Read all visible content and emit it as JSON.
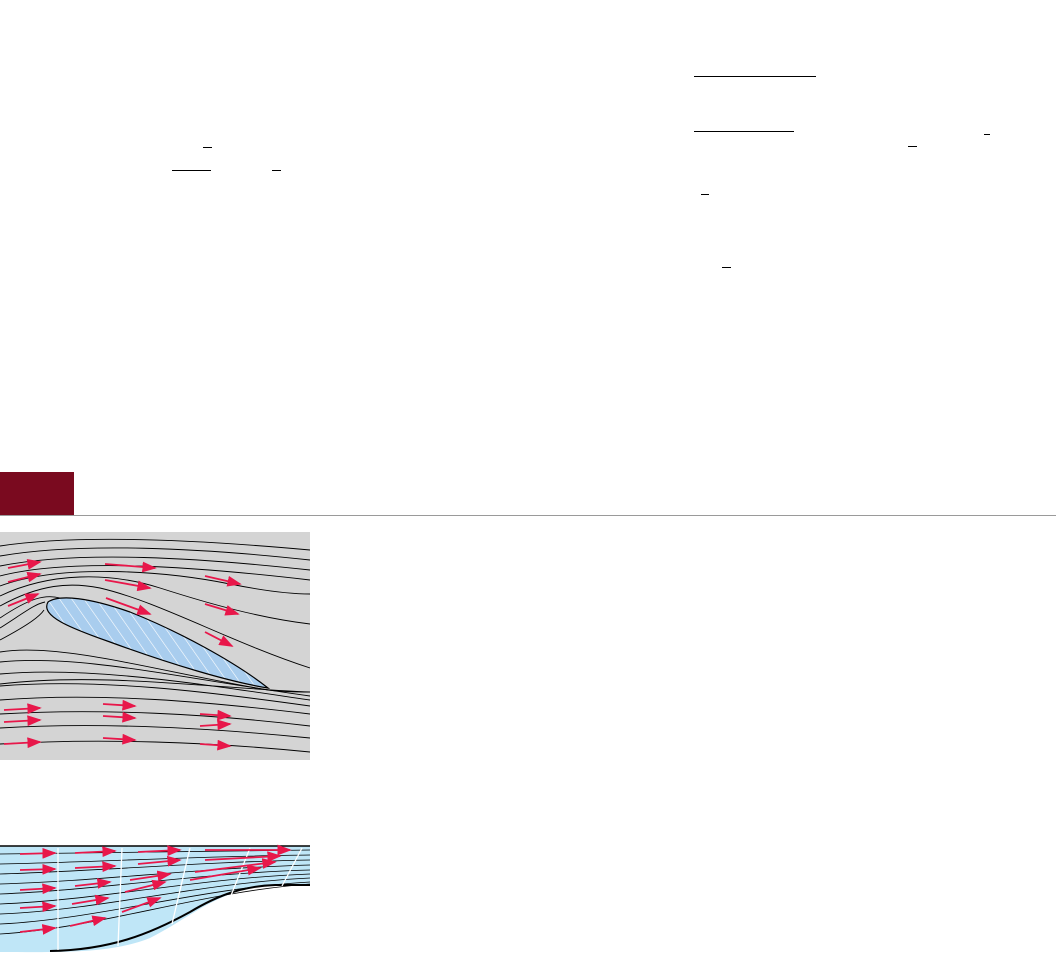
{
  "page": {
    "background": "#ffffff",
    "accent_color": "#7a0a1f",
    "rule_color": "#9a9a9a"
  },
  "equation_fragments": {
    "left_column": [
      "fraction-bar",
      "fraction-bar",
      "fraction-bar"
    ],
    "right_column": [
      "fraction-bar",
      "fraction-bar",
      "fraction-bar",
      "fraction-bar",
      "fraction-bar",
      "fraction-bar"
    ]
  },
  "section_header": {
    "tab_color": "#7a0a1f"
  },
  "figures": {
    "airfoil": {
      "description_icon": "airfoil-streamline-figure",
      "background_color": "#d4d4d4",
      "body_color": "#a9cdee",
      "arrow_color": "#e8174a",
      "streamline_color": "#000000"
    },
    "channel": {
      "description_icon": "converging-channel-streamline-figure",
      "fluid_color": "#bfe6f7",
      "arrow_color": "#e8174a",
      "streamline_color": "#000000"
    }
  }
}
